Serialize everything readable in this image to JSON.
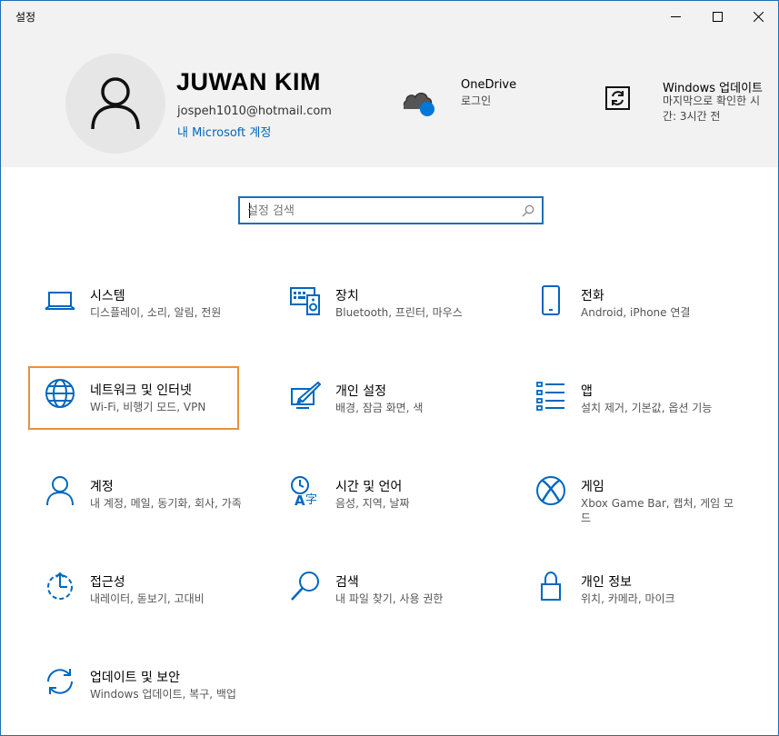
{
  "window": {
    "title": "설정"
  },
  "user": {
    "name": "JUWAN KIM",
    "email": "jospeh1010@hotmail.com",
    "account_link": "내 Microsoft 계정"
  },
  "onedrive": {
    "title": "OneDrive",
    "subtitle": "로그인"
  },
  "windows_update": {
    "title": "Windows 업데이트",
    "subtitle": "마지막으로 확인한 시간: 3시간 전"
  },
  "search": {
    "placeholder": "설정 검색",
    "value": ""
  },
  "tiles": [
    {
      "name": "시스템",
      "desc": "디스플레이, 소리, 알림, 전원",
      "icon": "laptop-icon"
    },
    {
      "name": "장치",
      "desc": "Bluetooth, 프린터, 마우스",
      "icon": "devices-icon"
    },
    {
      "name": "전화",
      "desc": "Android, iPhone 연결",
      "icon": "phone-icon"
    },
    {
      "name": "네트워크 및 인터넷",
      "desc": "Wi-Fi, 비행기 모드, VPN",
      "icon": "globe-icon"
    },
    {
      "name": "개인 설정",
      "desc": "배경, 잠금 화면, 색",
      "icon": "personalization-icon"
    },
    {
      "name": "앱",
      "desc": "설치 제거, 기본값, 옵션 기능",
      "icon": "apps-list-icon"
    },
    {
      "name": "계정",
      "desc": "내 계정, 메일, 동기화, 회사, 가족",
      "icon": "person-icon"
    },
    {
      "name": "시간 및 언어",
      "desc": "음성, 지역, 날짜",
      "icon": "time-language-icon"
    },
    {
      "name": "게임",
      "desc": "Xbox Game Bar, 캡처, 게임 모드",
      "icon": "xbox-icon"
    },
    {
      "name": "접근성",
      "desc": "내레이터, 돋보기, 고대비",
      "icon": "ease-of-access-icon"
    },
    {
      "name": "검색",
      "desc": "내 파일 찾기, 사용 권한",
      "icon": "magnifier-icon"
    },
    {
      "name": "개인 정보",
      "desc": "위치, 카메라, 마이크",
      "icon": "lock-icon"
    },
    {
      "name": "업데이트 및 보안",
      "desc": "Windows 업데이트, 복구, 백업",
      "icon": "sync-icon"
    }
  ],
  "colors": {
    "accent": "#0067c0",
    "selected_border": "#e8923a",
    "header_bg": "#f2f2f2"
  }
}
